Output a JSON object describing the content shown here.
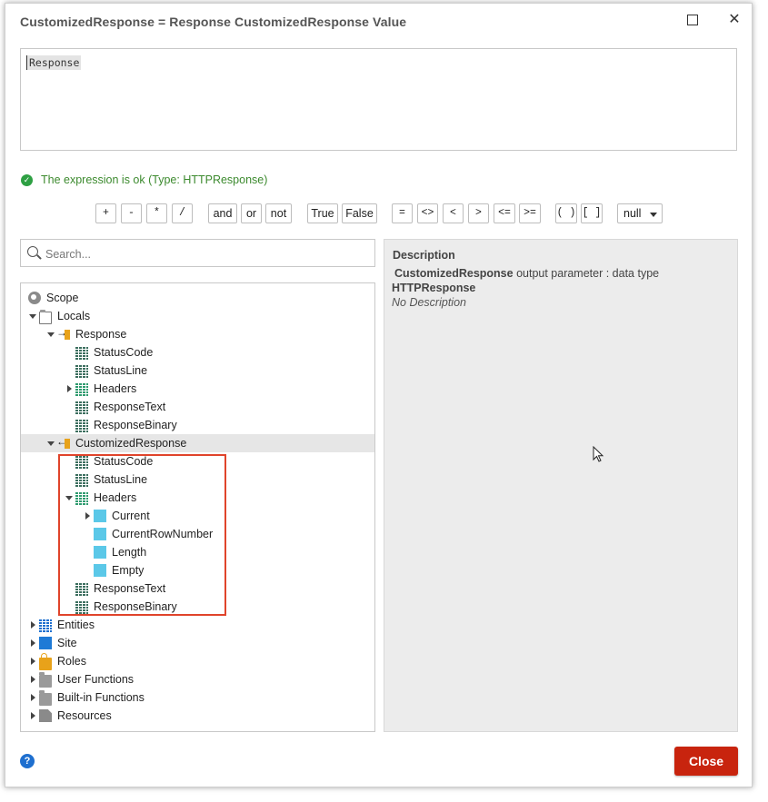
{
  "dialog": {
    "title": "CustomizedResponse = Response CustomizedResponse  Value",
    "close_glyph": "✕"
  },
  "editor": {
    "text": "Response"
  },
  "status": {
    "text": "The expression is ok (Type: HTTPResponse)"
  },
  "operators": [
    "+",
    "-",
    "*",
    "/",
    "and",
    "or",
    "not",
    "True",
    "False",
    "=",
    "<>",
    "<",
    ">",
    "<=",
    ">=",
    "( )",
    "[ ]"
  ],
  "null_select": {
    "value": "null"
  },
  "search": {
    "placeholder": "Search..."
  },
  "tree": [
    {
      "label": "Scope",
      "icon": "scope-icon"
    },
    {
      "label": "Locals",
      "icon": "folder-open-icon"
    },
    {
      "label": "Response",
      "icon": "input-parameter-icon"
    },
    {
      "label": "StatusCode",
      "icon": "structure-icon"
    },
    {
      "label": "StatusLine",
      "icon": "structure-icon"
    },
    {
      "label": "Headers",
      "icon": "list-icon"
    },
    {
      "label": "ResponseText",
      "icon": "structure-icon"
    },
    {
      "label": "ResponseBinary",
      "icon": "structure-icon"
    },
    {
      "label": "CustomizedResponse",
      "icon": "output-parameter-icon"
    },
    {
      "label": "StatusCode",
      "icon": "structure-icon"
    },
    {
      "label": "StatusLine",
      "icon": "structure-icon"
    },
    {
      "label": "Headers",
      "icon": "list-icon"
    },
    {
      "label": "Current",
      "icon": "attribute-icon"
    },
    {
      "label": "CurrentRowNumber",
      "icon": "attribute-icon"
    },
    {
      "label": "Length",
      "icon": "attribute-icon"
    },
    {
      "label": "Empty",
      "icon": "attribute-icon"
    },
    {
      "label": "ResponseText",
      "icon": "structure-icon"
    },
    {
      "label": "ResponseBinary",
      "icon": "structure-icon"
    },
    {
      "label": "Entities",
      "icon": "entities-icon"
    },
    {
      "label": "Site",
      "icon": "site-icon"
    },
    {
      "label": "Roles",
      "icon": "lock-icon"
    },
    {
      "label": "User Functions",
      "icon": "folder-icon"
    },
    {
      "label": "Built-in Functions",
      "icon": "folder-icon"
    },
    {
      "label": "Resources",
      "icon": "document-icon"
    }
  ],
  "description": {
    "title": "Description",
    "name": "CustomizedResponse",
    "text": " output parameter : data type",
    "type": "HTTPResponse",
    "none": "No Description"
  },
  "help": {
    "glyph": "?"
  },
  "close_button": {
    "label": "Close"
  },
  "colors": {
    "accent": "#c8240e",
    "ok": "#3c8a2e",
    "highlight": "#e0442b"
  }
}
